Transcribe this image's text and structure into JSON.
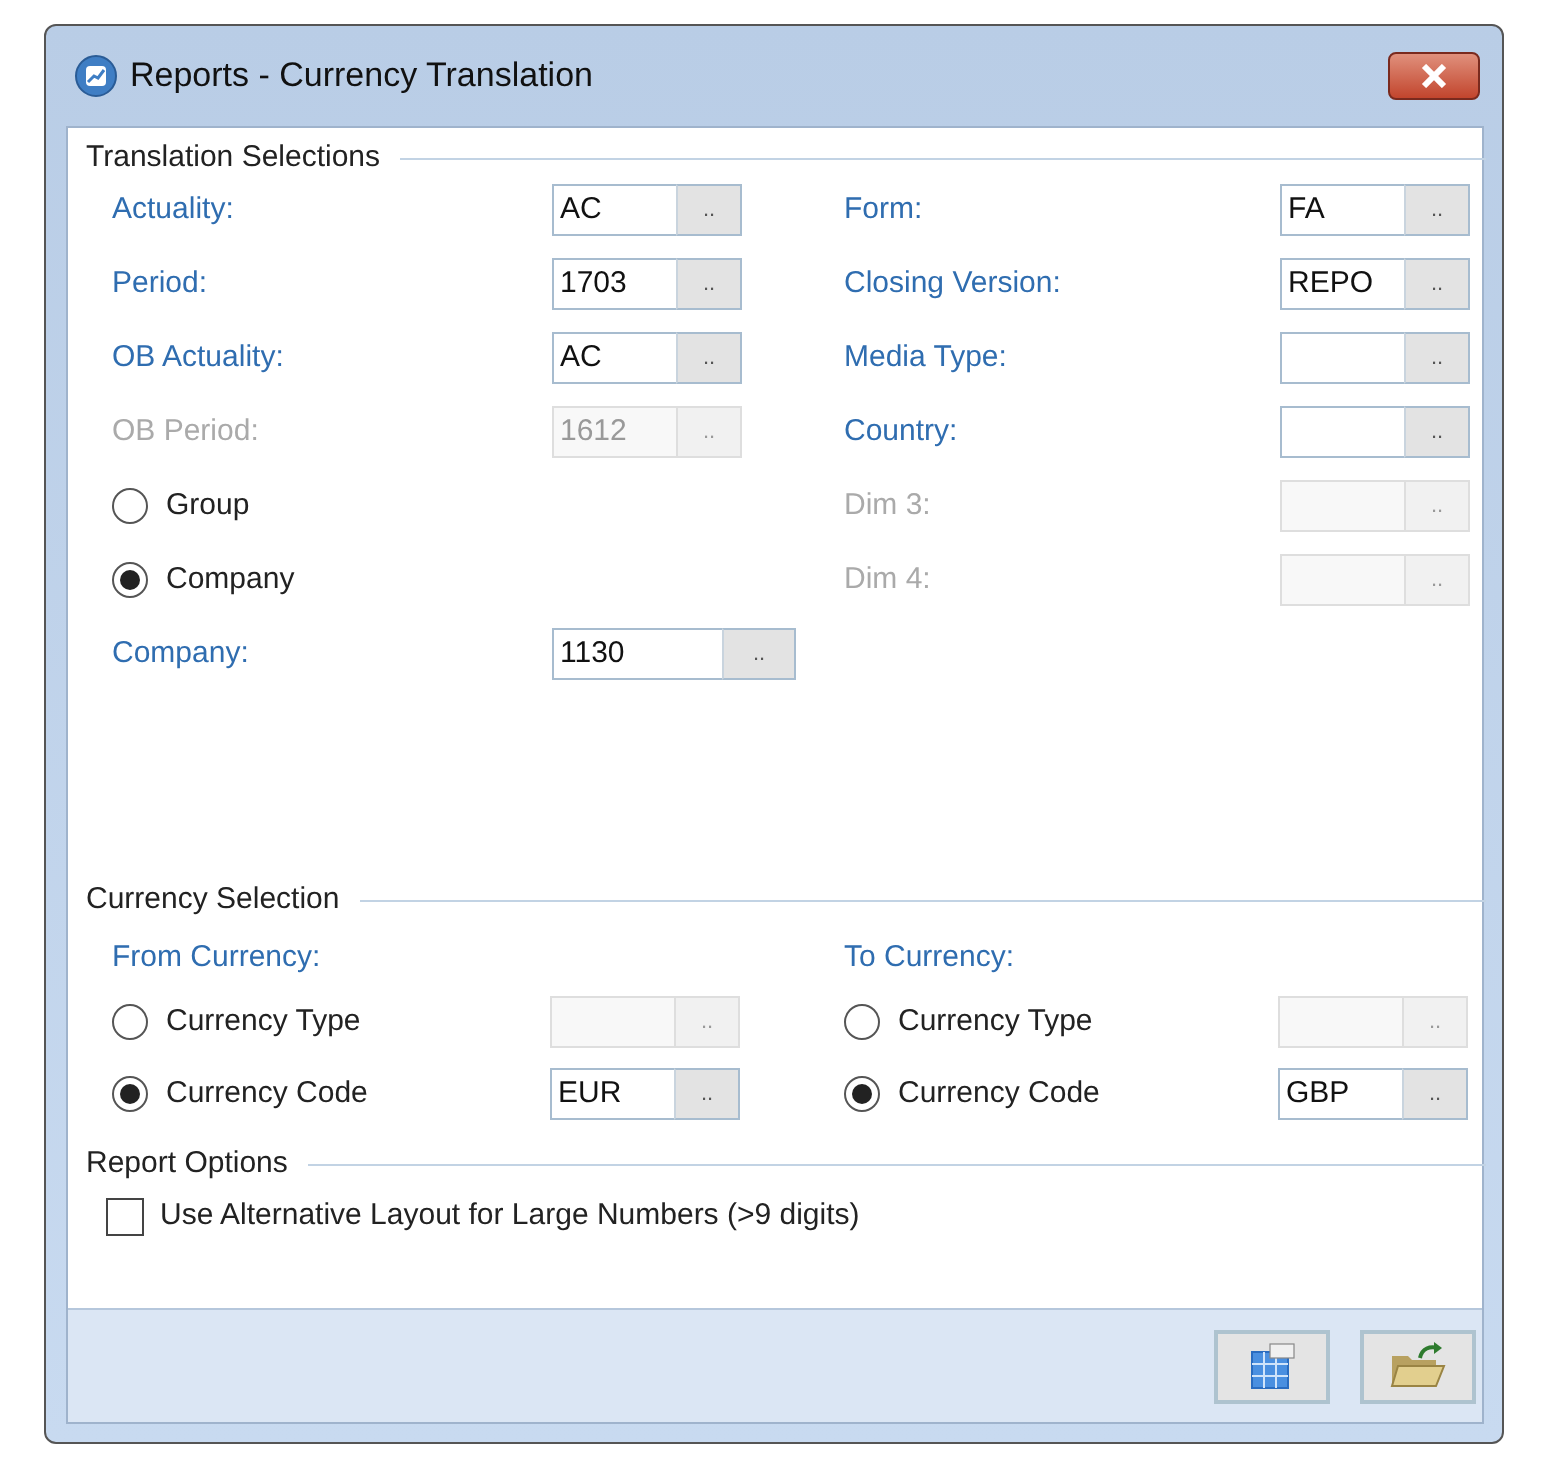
{
  "window": {
    "title": "Reports - Currency Translation"
  },
  "translation_selections": {
    "title": "Translation Selections",
    "left": [
      {
        "kind": "field",
        "label": "Actuality:",
        "value": "AC",
        "button": "..",
        "disabled": false
      },
      {
        "kind": "field",
        "label": "Period:",
        "value": "1703",
        "button": "..",
        "disabled": false
      },
      {
        "kind": "field",
        "label": "OB Actuality:",
        "value": "AC",
        "button": "..",
        "disabled": false
      },
      {
        "kind": "field",
        "label": "OB Period:",
        "value": "1612",
        "button": "..",
        "disabled": true
      },
      {
        "kind": "radio",
        "label": "Group",
        "selected": false
      },
      {
        "kind": "radio",
        "label": "Company",
        "selected": true
      },
      {
        "kind": "wide_field",
        "label": "Company:",
        "value": "1130",
        "button": "..",
        "disabled": false
      }
    ],
    "right": [
      {
        "kind": "field",
        "label": "Form:",
        "value": "FA",
        "button": "..",
        "disabled": false
      },
      {
        "kind": "field",
        "label": "Closing Version:",
        "value": "REPO",
        "button": "..",
        "disabled": false
      },
      {
        "kind": "field",
        "label": "Media Type:",
        "button": "..",
        "disabled": false
      },
      {
        "kind": "field",
        "label": "Country:",
        "button": "..",
        "disabled": false
      },
      {
        "kind": "field",
        "label": "Dim 3:",
        "button": "..",
        "disabled": true
      },
      {
        "kind": "field",
        "label": "Dim 4:",
        "button": "..",
        "disabled": true
      }
    ]
  },
  "currency_selection": {
    "title": "Currency Selection",
    "groups": [
      {
        "label": "From Currency:",
        "options": [
          {
            "label": "Currency Type",
            "selected": false,
            "button": "..",
            "disabled": true
          },
          {
            "label": "Currency Code",
            "selected": true,
            "value": "EUR",
            "button": "..",
            "disabled": false
          }
        ]
      },
      {
        "label": "To Currency:",
        "options": [
          {
            "label": "Currency Type",
            "selected": false,
            "button": "..",
            "disabled": true
          },
          {
            "label": "Currency Code",
            "selected": true,
            "value": "GBP",
            "button": "..",
            "disabled": false
          }
        ]
      }
    ]
  },
  "report_options": {
    "title": "Report Options",
    "options": [
      {
        "label": "Use Alternative Layout for Large Numbers (>9 digits)",
        "checked": false
      }
    ]
  },
  "buttons": [
    {
      "kind": "report"
    },
    {
      "kind": "open"
    }
  ]
}
